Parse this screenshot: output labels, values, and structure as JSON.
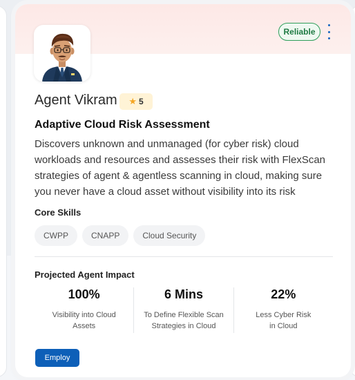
{
  "card": {
    "badge": "Reliable",
    "agent_name": "Agent Vikram",
    "rating": "5",
    "title": "Adaptive Cloud Risk Assessment",
    "description": "Discovers unknown and unmanaged (for cyber risk) cloud workloads and resources and assesses their risk with FlexScan strategies of agent & agentless scanning in cloud, making sure you never have a cloud asset without visibility into its risk",
    "skills_label": "Core Skills",
    "skills": [
      "CWPP",
      "CNAPP",
      "Cloud Security"
    ],
    "impact_label": "Projected Agent Impact",
    "metrics": [
      {
        "value": "100%",
        "desc": "Visibility into Cloud Assets"
      },
      {
        "value": "6 Mins",
        "desc": "To Define Flexible Scan Strategies in Cloud"
      },
      {
        "value": "22%",
        "desc": "Less Cyber Risk in Cloud"
      }
    ],
    "employ_label": "Employ"
  },
  "icons": {
    "menu": "kebab-menu-icon",
    "rating": "star-icon",
    "avatar": "agent-avatar"
  },
  "colors": {
    "accent": "#0d5fb8",
    "badge": "#2e9e5a",
    "header": "#fde8e6",
    "rating_bg": "#fff3d6"
  }
}
